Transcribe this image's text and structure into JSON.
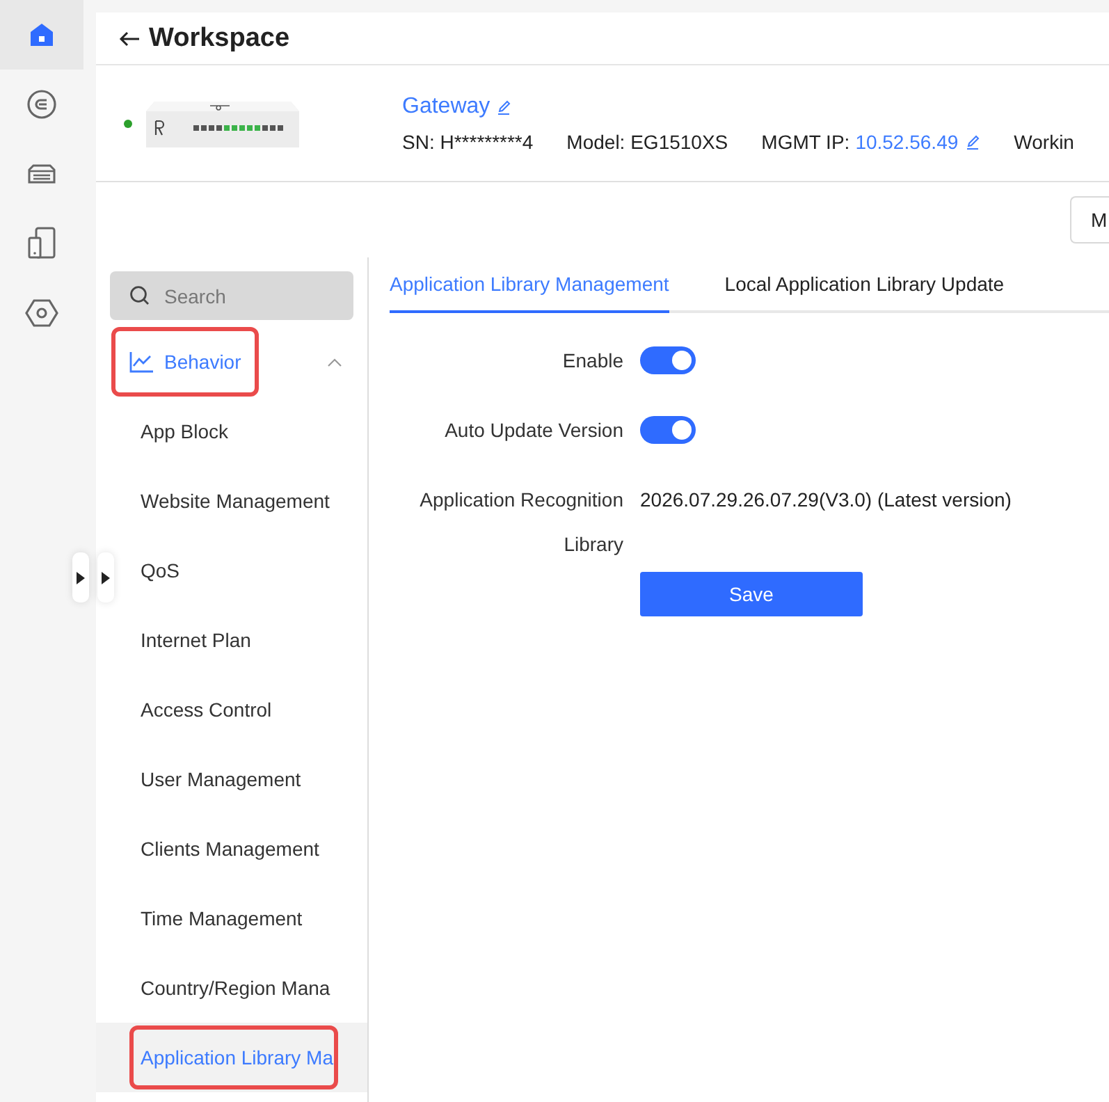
{
  "rail": {
    "items": [
      {
        "kind": "home",
        "selected": true
      },
      {
        "kind": "circle",
        "selected": false
      },
      {
        "kind": "device",
        "selected": false
      },
      {
        "kind": "clients",
        "selected": false
      },
      {
        "kind": "hexagon",
        "selected": false
      }
    ]
  },
  "header": {
    "title": "Workspace"
  },
  "device": {
    "online": true,
    "name": "Gateway",
    "sn_label": "SN:",
    "sn": "H*********4",
    "model_label": "Model:",
    "model": "EG1510XS",
    "ip_label": "MGMT IP:",
    "ip": "10.52.56.49",
    "extra": "Workin"
  },
  "toolbar": {
    "button": "M"
  },
  "menu": {
    "search": {
      "placeholder": "Search"
    },
    "group": {
      "label": "Behavior",
      "expanded": true,
      "highlighted": true
    },
    "items": [
      {
        "label": "App Block",
        "selected": false,
        "highlighted": false
      },
      {
        "label": "Website Management",
        "selected": false,
        "highlighted": false
      },
      {
        "label": "QoS",
        "selected": false,
        "highlighted": false
      },
      {
        "label": "Internet Plan",
        "selected": false,
        "highlighted": false
      },
      {
        "label": "Access Control",
        "selected": false,
        "highlighted": false
      },
      {
        "label": "User Management",
        "selected": false,
        "highlighted": false
      },
      {
        "label": "Clients Management",
        "selected": false,
        "highlighted": false
      },
      {
        "label": "Time Management",
        "selected": false,
        "highlighted": false
      },
      {
        "label": "Country/Region Mana",
        "selected": false,
        "highlighted": false
      },
      {
        "label": "Application Library Ma",
        "selected": true,
        "highlighted": true
      }
    ]
  },
  "tabs": [
    {
      "label": "Application Library Management",
      "selected": true
    },
    {
      "label": "Local Application Library Update",
      "selected": false
    }
  ],
  "form": {
    "rows": [
      {
        "kind": "toggle",
        "label": "Enable",
        "on": true
      },
      {
        "kind": "toggle",
        "label": "Auto Update Version",
        "on": true
      },
      {
        "kind": "text",
        "label": "Application Recognition Library",
        "value": "2026.07.29.26.07.29(V3.0) (Latest version)"
      }
    ],
    "save": "Save"
  }
}
